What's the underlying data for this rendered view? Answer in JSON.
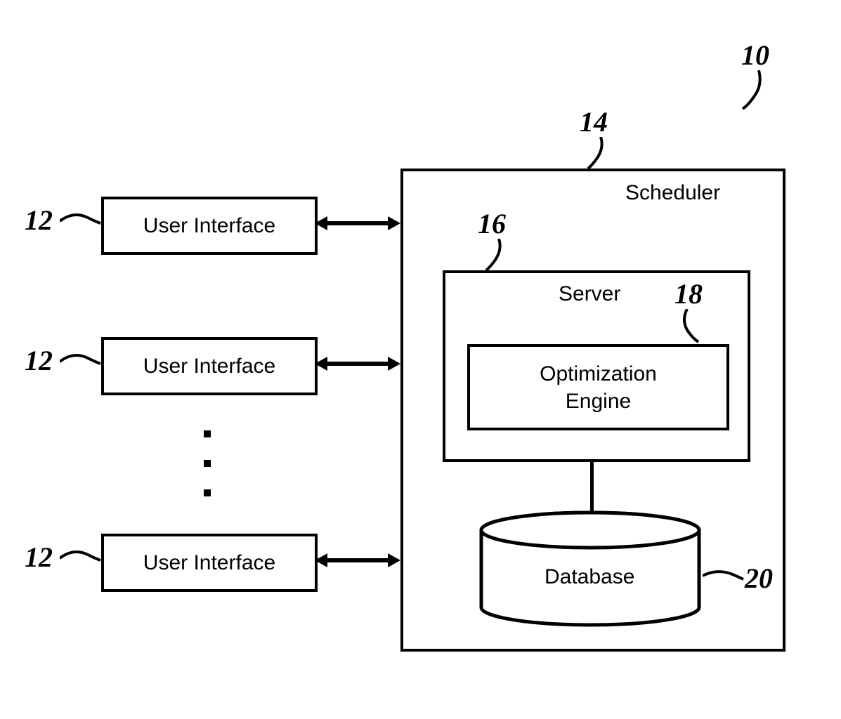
{
  "labels": {
    "system": "10",
    "ui1": "12",
    "ui2": "12",
    "ui3": "12",
    "scheduler": "14",
    "server": "16",
    "optimizer": "18",
    "database": "20"
  },
  "boxes": {
    "ui": "User Interface",
    "scheduler": "Scheduler",
    "server": "Server",
    "optimizer": "Optimization\nEngine",
    "database": "Database"
  }
}
